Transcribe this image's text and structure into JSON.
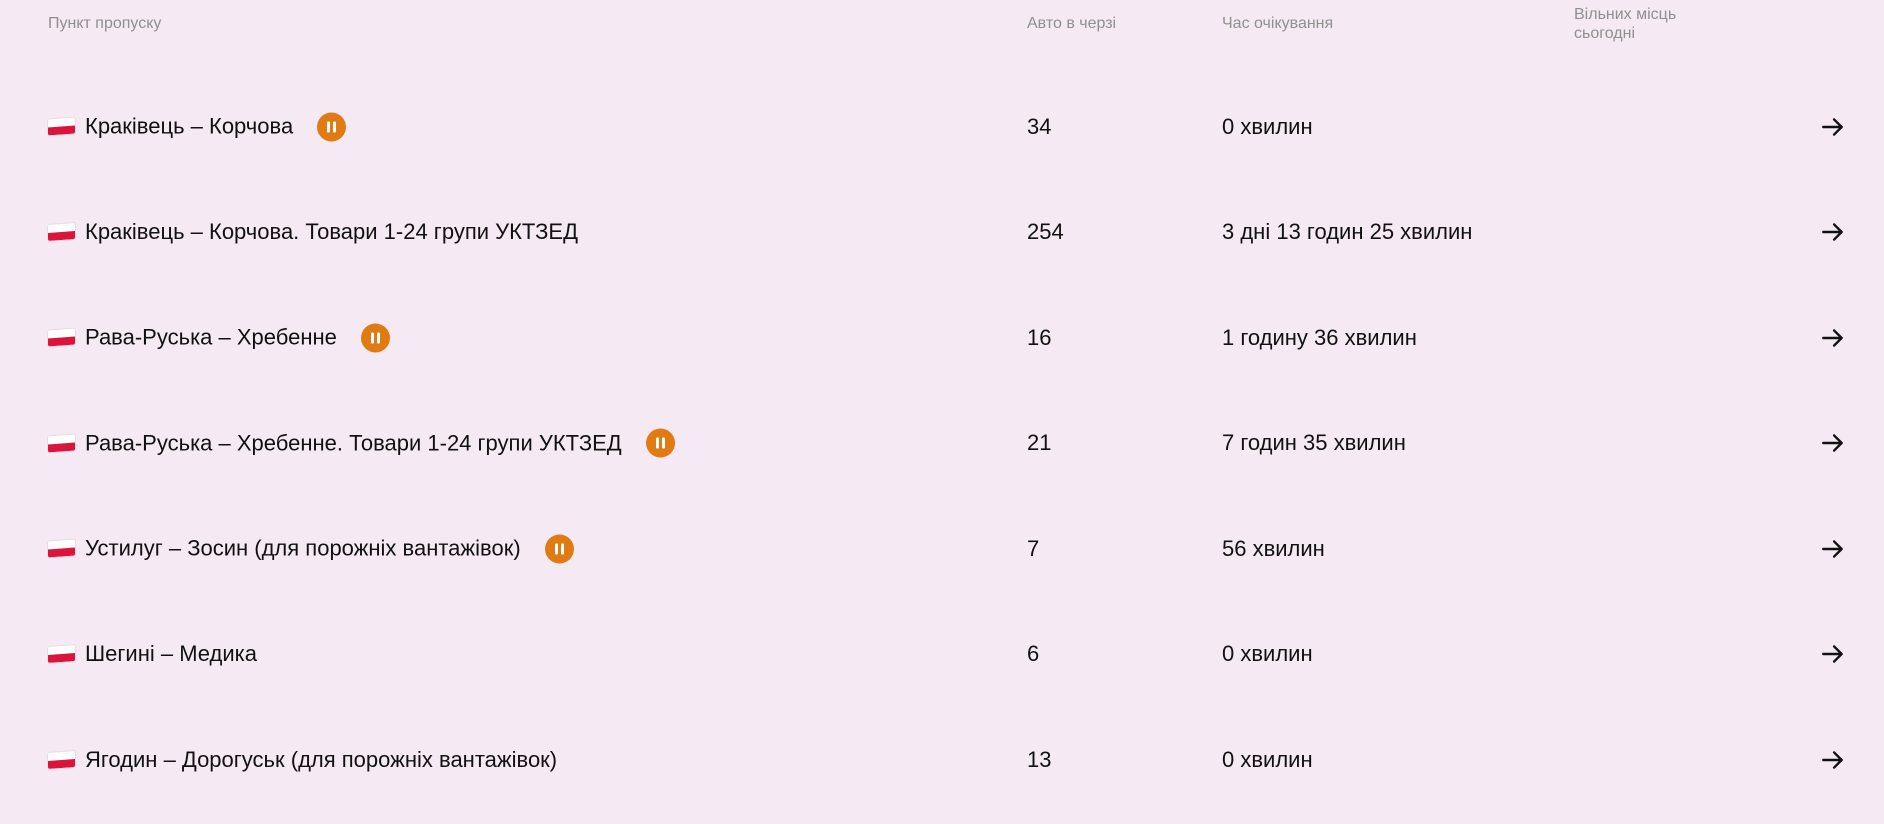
{
  "table": {
    "headers": {
      "checkpoint": "Пункт пропуску",
      "cars_in_queue": "Авто в черзі",
      "wait_time": "Час очікування",
      "free_slots_today": "Вільних місць сьогодні"
    },
    "rows": [
      {
        "flag_icon": "poland-flag-icon",
        "name": "Краківець – Корчова",
        "paused": true,
        "queue": "34",
        "wait": "0 хвилин",
        "free": ""
      },
      {
        "flag_icon": "poland-flag-icon",
        "name": "Краківець – Корчова. Товари 1-24 групи УКТЗЕД",
        "paused": false,
        "queue": "254",
        "wait": "3 дні 13 годин 25 хвилин",
        "free": ""
      },
      {
        "flag_icon": "poland-flag-icon",
        "name": "Рава-Руська – Хребенне",
        "paused": true,
        "queue": "16",
        "wait": "1 годину 36 хвилин",
        "free": ""
      },
      {
        "flag_icon": "poland-flag-icon",
        "name": "Рава-Руська – Хребенне. Товари 1-24 групи УКТЗЕД",
        "paused": true,
        "queue": "21",
        "wait": "7 годин 35 хвилин",
        "free": ""
      },
      {
        "flag_icon": "poland-flag-icon",
        "name": "Устилуг – Зосин (для порожніх вантажівок)",
        "paused": true,
        "queue": "7",
        "wait": "56 хвилин",
        "free": ""
      },
      {
        "flag_icon": "poland-flag-icon",
        "name": "Шегині – Медика",
        "paused": false,
        "queue": "6",
        "wait": "0 хвилин",
        "free": ""
      },
      {
        "flag_icon": "poland-flag-icon",
        "name": "Ягодин – Дорогуськ (для порожніх вантажівок)",
        "paused": false,
        "queue": "13",
        "wait": "0 хвилин",
        "free": ""
      }
    ],
    "icons": {
      "pause": "pause-icon",
      "arrow": "arrow-right-icon"
    }
  },
  "colors": {
    "background": "#f5eaf4",
    "pause_badge": "#e07a12",
    "header_text": "#8f8f8f",
    "body_text": "#111111"
  }
}
